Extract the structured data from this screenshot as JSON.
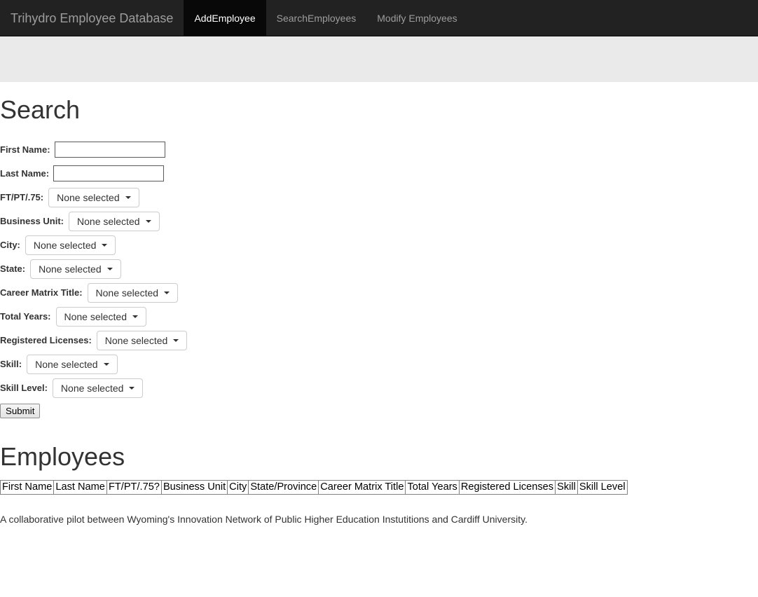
{
  "navbar": {
    "brand": "Trihydro Employee Database",
    "links": [
      {
        "label": "AddEmployee",
        "active": true
      },
      {
        "label": "SearchEmployees",
        "active": false
      },
      {
        "label": "Modify Employees",
        "active": false
      }
    ],
    "background_color": "#222222",
    "active_background_color": "#080808",
    "link_color": "#9d9d9d",
    "active_link_color": "#ffffff"
  },
  "jumbotron": {
    "background_color": "#eaeaea"
  },
  "search": {
    "heading": "Search",
    "fields": [
      {
        "label": "First Name:",
        "type": "text",
        "value": "",
        "placeholder": ""
      },
      {
        "label": "Last Name:",
        "type": "text",
        "value": "",
        "placeholder": ""
      },
      {
        "label": "FT/PT/.75:",
        "type": "dropdown",
        "value": "None selected"
      },
      {
        "label": "Business Unit:",
        "type": "dropdown",
        "value": "None selected"
      },
      {
        "label": "City:",
        "type": "dropdown",
        "value": "None selected"
      },
      {
        "label": "State:",
        "type": "dropdown",
        "value": "None selected"
      },
      {
        "label": "Career Matrix Title:",
        "type": "dropdown",
        "value": "None selected"
      },
      {
        "label": "Total Years:",
        "type": "dropdown",
        "value": "None selected"
      },
      {
        "label": "Registered Licenses:",
        "type": "dropdown",
        "value": "None selected"
      },
      {
        "label": "Skill:",
        "type": "dropdown",
        "value": "None selected"
      },
      {
        "label": "Skill Level:",
        "type": "dropdown",
        "value": "None selected"
      }
    ],
    "submit_label": "Submit"
  },
  "employees": {
    "heading": "Employees",
    "columns": [
      "First Name",
      "Last Name",
      "FT/PT/.75?",
      "Business Unit",
      "City",
      "State/Province",
      "Career Matrix Title",
      "Total Years",
      "Registered Licenses",
      "Skill",
      "Skill Level"
    ],
    "rows": []
  },
  "footer": {
    "note": "A collaborative pilot between Wyoming's Innovation Network of Public Higher Education Instutitions and Cardiff University."
  }
}
